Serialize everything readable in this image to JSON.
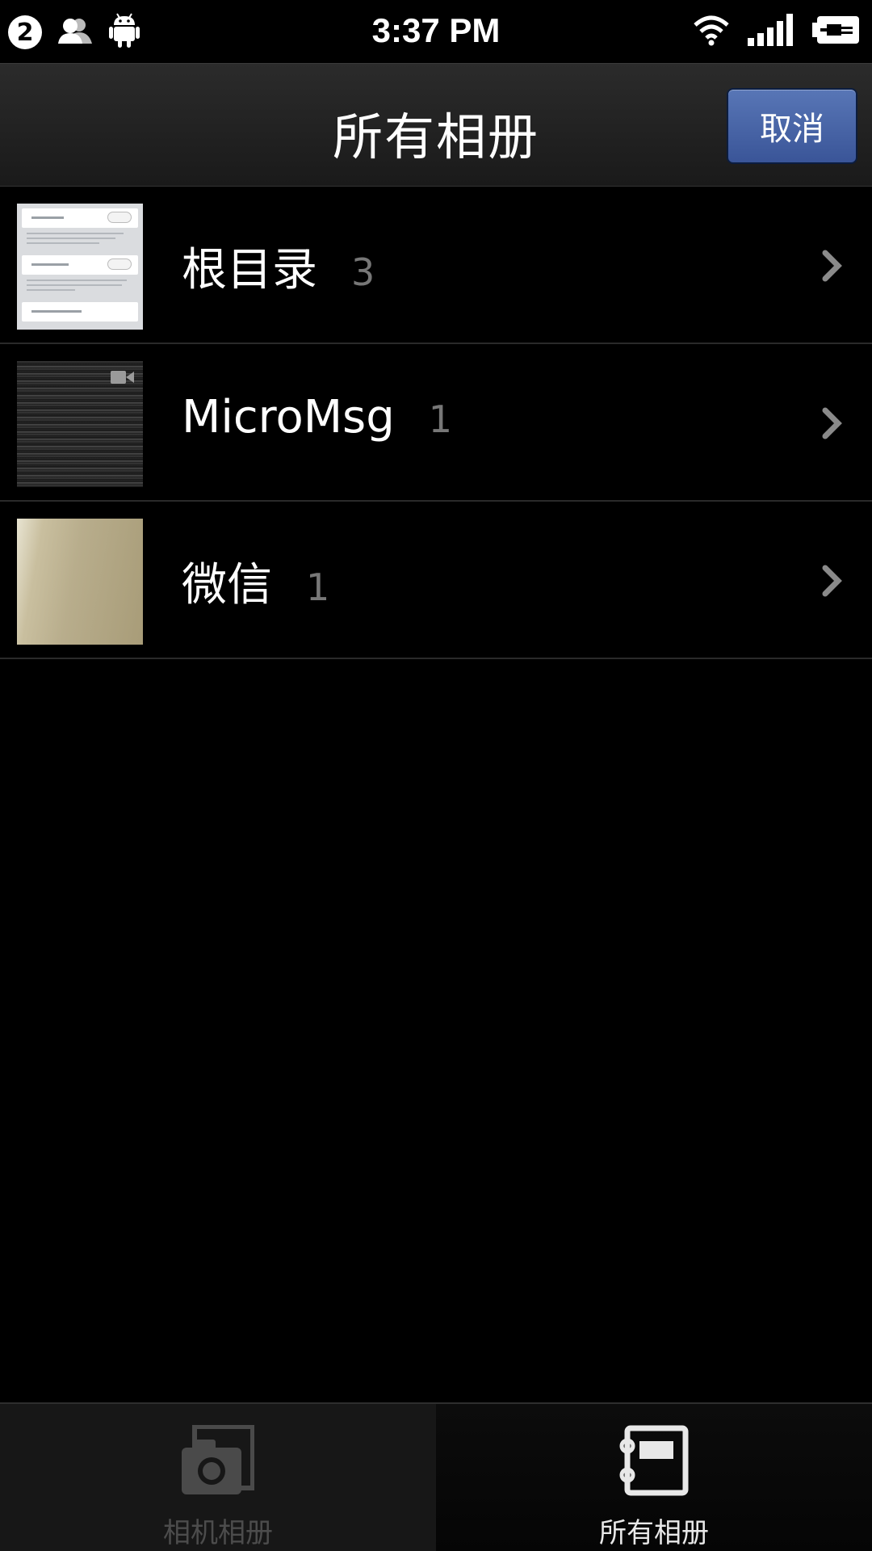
{
  "status_bar": {
    "notification_count": "2",
    "time": "3:37 PM",
    "icons": [
      "contacts-icon",
      "android-icon",
      "wifi-icon",
      "signal-icon",
      "battery-charging-icon"
    ]
  },
  "header": {
    "title": "所有相册",
    "cancel_label": "取消"
  },
  "albums": [
    {
      "name": "根目录",
      "count": "3",
      "thumbnail": "settings-screenshot"
    },
    {
      "name": "MicroMsg",
      "count": "1",
      "thumbnail": "video-noise"
    },
    {
      "name": "微信",
      "count": "1",
      "thumbnail": "beige-photo"
    }
  ],
  "tabs": [
    {
      "label": "相机相册",
      "icon": "camera-icon",
      "active": false
    },
    {
      "label": "所有相册",
      "icon": "album-book-icon",
      "active": true
    }
  ],
  "colors": {
    "cancel_button": "#3f5a9c",
    "active_tab_text": "#e8e8e8",
    "inactive_tab_text": "#4c4c4c",
    "count_text": "#777777"
  }
}
